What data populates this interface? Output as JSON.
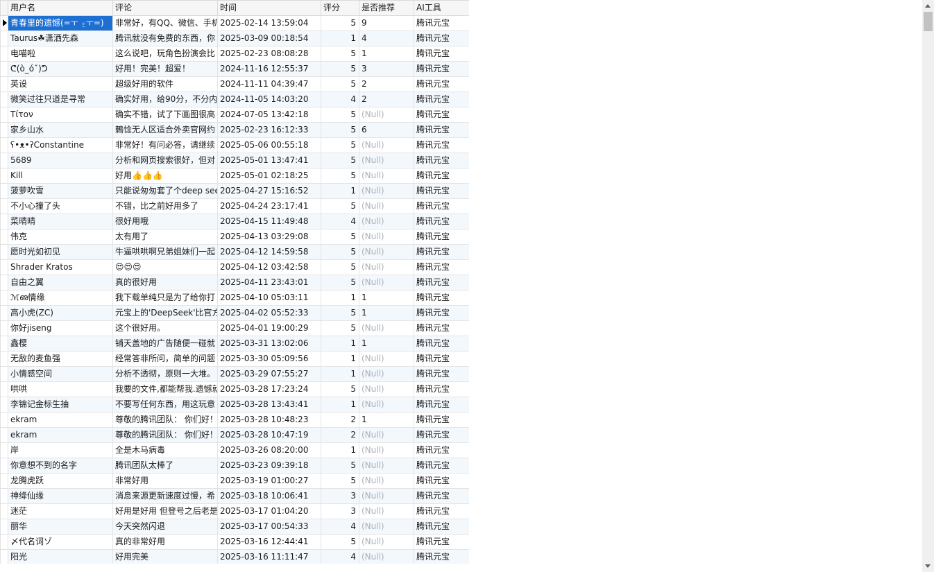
{
  "columns": [
    "用户名",
    "评论",
    "时间",
    "评分",
    "是否推荐",
    "AI工具"
  ],
  "null_text": "(Null)",
  "icons": {
    "row_indicator": "triangle-right-icon"
  },
  "colors": {
    "selection": "#1e6fd2",
    "alt_row": "#f3f8fd",
    "null_text": "#aab0b8"
  },
  "rows": [
    [
      "青春里的遗憾(=ㅜ ⍛ㅜ=)",
      "非常好，有QQ、微信、手机",
      "2025-02-14 13:59:04",
      "5",
      "9",
      "腾讯元宝"
    ],
    [
      "Taurus☘潇洒先森",
      "腾讯就没有免费的东西，你",
      "2025-03-09 00:18:54",
      "1",
      "4",
      "腾讯元宝"
    ],
    [
      "电喵啦",
      "这么说吧，玩角色扮演会比",
      "2025-02-23 08:08:28",
      "5",
      "1",
      "腾讯元宝"
    ],
    [
      "ᕦ(ò_óˇ)ᕤ",
      "好用！完美！超爱！",
      "2024-11-16 12:55:37",
      "5",
      "3",
      "腾讯元宝"
    ],
    [
      "英设",
      "超级好用的软件",
      "2024-11-11 04:39:47",
      "5",
      "2",
      "腾讯元宝"
    ],
    [
      "微笑过往只道是寻常",
      "确实好用，给90分，不分内",
      "2024-11-05 14:03:20",
      "4",
      "2",
      "腾讯元宝"
    ],
    [
      "Tίτον",
      "确实不错，试了下画图很高",
      "2024-07-05 13:42:18",
      "5",
      null,
      "腾讯元宝"
    ],
    [
      "家乡山水",
      "鶇惗无人区适合外卖官网约",
      "2025-02-23 16:12:33",
      "5",
      "6",
      "腾讯元宝"
    ],
    [
      "ʕ•ᴥ•ʔConstantine",
      "非常好！有问必答，请继续",
      "2025-05-06 00:55:18",
      "5",
      null,
      "腾讯元宝"
    ],
    [
      "5689",
      "分析和网页搜索很好，但对",
      "2025-05-01 13:47:41",
      "5",
      null,
      "腾讯元宝"
    ],
    [
      "Kill",
      "好用👍👍👍",
      "2025-05-01 02:18:25",
      "5",
      null,
      "腾讯元宝"
    ],
    [
      "菠萝吹雪",
      "只能说匆匆套了个deep see",
      "2025-04-27 15:16:52",
      "1",
      null,
      "腾讯元宝"
    ],
    [
      "不小心撞了头",
      "不错，比之前好用多了",
      "2025-04-24 23:17:41",
      "5",
      null,
      "腾讯元宝"
    ],
    [
      "菜晴晴",
      "很好用哦",
      "2025-04-15 11:49:48",
      "4",
      null,
      "腾讯元宝"
    ],
    [
      "伟克",
      "太有用了",
      "2025-04-13 03:29:08",
      "5",
      null,
      "腾讯元宝"
    ],
    [
      "愿时光如初见",
      "牛逼哄哄啊兄弟姐妹们一起",
      "2025-04-12 14:59:58",
      "5",
      null,
      "腾讯元宝"
    ],
    [
      "Shrader Kratos",
      "😍😍😍",
      "2025-04-12 03:42:58",
      "5",
      null,
      "腾讯元宝"
    ],
    [
      "自由之翼",
      "真的很好用",
      "2025-04-11 23:43:01",
      "5",
      null,
      "腾讯元宝"
    ],
    [
      "ℳഌ情缘",
      "我下载单纯只是为了给你打",
      "2025-04-10 05:03:11",
      "1",
      "1",
      "腾讯元宝"
    ],
    [
      "高小虎(ZC)",
      "元宝上的'DeepSeek'比官方",
      "2025-04-02 05:52:33",
      "5",
      "1",
      "腾讯元宝"
    ],
    [
      "你好jiseng",
      "这个很好用。",
      "2025-04-01 19:00:29",
      "5",
      null,
      "腾讯元宝"
    ],
    [
      "鑫樱",
      "铺天盖地的广告随便一碰就",
      "2025-03-31 13:02:06",
      "1",
      "1",
      "腾讯元宝"
    ],
    [
      "无敌的麦鱼强",
      "经常答非所问，简单的问题",
      "2025-03-30 05:09:56",
      "1",
      null,
      "腾讯元宝"
    ],
    [
      "小情感空间",
      "分析不透彻，原则一大堆。",
      "2025-03-29 07:55:27",
      "1",
      null,
      "腾讯元宝"
    ],
    [
      "哄哄",
      "我要的文件,都能帮我.遗憾就",
      "2025-03-28 17:23:24",
      "5",
      null,
      "腾讯元宝"
    ],
    [
      "李锦记金标生抽",
      "不要写任何东西，用这玩意",
      "2025-03-28 13:43:41",
      "1",
      null,
      "腾讯元宝"
    ],
    [
      "ekram",
      "尊敬的腾讯团队： 你们好！",
      "2025-03-28 10:48:23",
      "2",
      "1",
      "腾讯元宝"
    ],
    [
      "ekram",
      "尊敬的腾讯团队： 你们好！",
      "2025-03-28 10:47:19",
      "2",
      null,
      "腾讯元宝"
    ],
    [
      "岸",
      "全是木马病毒",
      "2025-03-26 08:20:00",
      "1",
      null,
      "腾讯元宝"
    ],
    [
      "你意想不到的名字",
      "腾讯团队太棒了",
      "2025-03-23 09:39:18",
      "5",
      null,
      "腾讯元宝"
    ],
    [
      "龙腾虎跃",
      "非常好用",
      "2025-03-19 01:00:27",
      "5",
      null,
      "腾讯元宝"
    ],
    [
      "神绛仙缘",
      "消息来源更新速度过慢，希",
      "2025-03-18 10:06:41",
      "3",
      null,
      "腾讯元宝"
    ],
    [
      "迷茫",
      "好用是好用 但登号之后老是",
      "2025-03-17 01:04:20",
      "3",
      null,
      "腾讯元宝"
    ],
    [
      "丽华",
      "今天突然闪退",
      "2025-03-17 00:54:33",
      "4",
      null,
      "腾讯元宝"
    ],
    [
      "〆代名词ゾ",
      "真的非常好用",
      "2025-03-16 12:44:41",
      "5",
      null,
      "腾讯元宝"
    ],
    [
      "阳光",
      "好用完美",
      "2025-03-16 11:11:47",
      "4",
      null,
      "腾讯元宝"
    ]
  ]
}
